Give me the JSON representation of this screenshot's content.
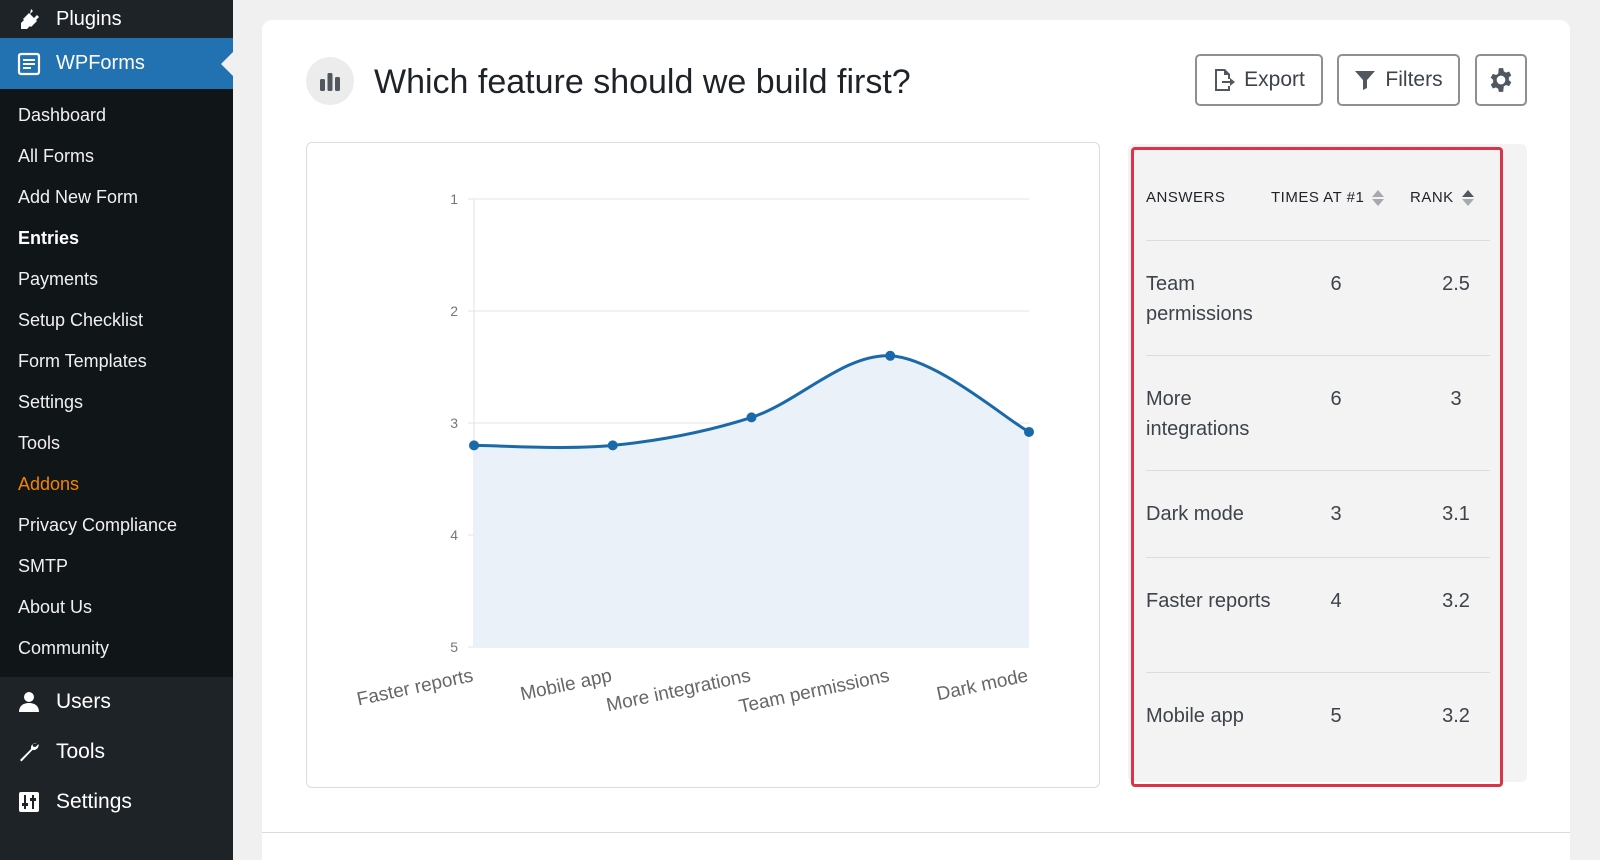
{
  "sidebar": {
    "plugins_label": "Plugins",
    "wpforms_label": "WPForms",
    "submenu": [
      {
        "label": "Dashboard"
      },
      {
        "label": "All Forms"
      },
      {
        "label": "Add New Form"
      },
      {
        "label": "Entries"
      },
      {
        "label": "Payments"
      },
      {
        "label": "Setup Checklist"
      },
      {
        "label": "Form Templates"
      },
      {
        "label": "Settings"
      },
      {
        "label": "Tools"
      },
      {
        "label": "Addons"
      },
      {
        "label": "Privacy Compliance"
      },
      {
        "label": "SMTP"
      },
      {
        "label": "About Us"
      },
      {
        "label": "Community"
      }
    ],
    "users_label": "Users",
    "tools_label": "Tools",
    "settings_label": "Settings"
  },
  "header": {
    "title": "Which feature should we build first?",
    "export_label": "Export",
    "filters_label": "Filters"
  },
  "table": {
    "col_answers": "ANSWERS",
    "col_times": "TIMES AT #1",
    "col_rank": "RANK",
    "rows": [
      {
        "answer": "Team permissions",
        "times": "6",
        "rank": "2.5"
      },
      {
        "answer": "More integrations",
        "times": "6",
        "rank": "3"
      },
      {
        "answer": "Dark mode",
        "times": "3",
        "rank": "3.1"
      },
      {
        "answer": "Faster reports",
        "times": "4",
        "rank": "3.2"
      },
      {
        "answer": "Mobile app",
        "times": "5",
        "rank": "3.2"
      }
    ]
  },
  "colors": {
    "accent": "#2271b1",
    "line": "#1a6aaa",
    "area": "#eaf1f8",
    "highlight": "#dc3349",
    "addons": "#f18500"
  },
  "chart_data": {
    "type": "area",
    "categories": [
      "Faster reports",
      "Mobile app",
      "More integrations",
      "Team permissions",
      "Dark mode"
    ],
    "values": [
      3.2,
      3.2,
      2.95,
      2.4,
      3.08
    ],
    "yticks": [
      "1",
      "2",
      "3",
      "4",
      "5"
    ],
    "ylim": [
      1,
      5
    ],
    "y_inverted": true,
    "grid": true
  }
}
